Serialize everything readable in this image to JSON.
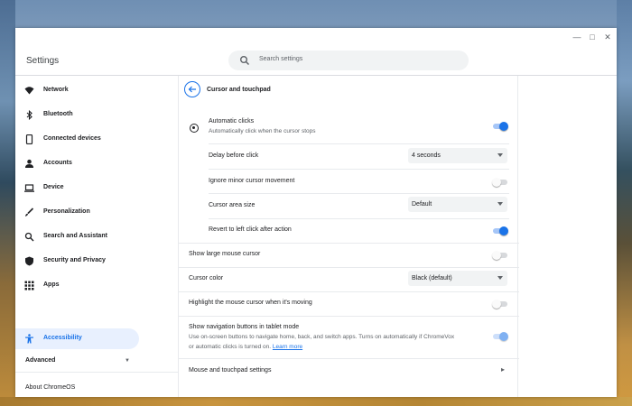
{
  "window": {
    "title": "Settings",
    "search_placeholder": "Search settings",
    "minimize_glyph": "—",
    "maximize_glyph": "□",
    "close_glyph": "✕"
  },
  "sidebar": {
    "items": [
      {
        "label": "Network",
        "icon": "wifi-icon"
      },
      {
        "label": "Bluetooth",
        "icon": "bluetooth-icon"
      },
      {
        "label": "Connected devices",
        "icon": "phone-icon"
      },
      {
        "label": "Accounts",
        "icon": "person-icon"
      },
      {
        "label": "Device",
        "icon": "laptop-icon"
      },
      {
        "label": "Personalization",
        "icon": "brush-icon"
      },
      {
        "label": "Search and Assistant",
        "icon": "search-icon"
      },
      {
        "label": "Security and Privacy",
        "icon": "shield-icon"
      },
      {
        "label": "Apps",
        "icon": "apps-grid-icon"
      },
      {
        "label": "Accessibility",
        "icon": "accessibility-icon",
        "active": true
      }
    ],
    "advanced_label": "Advanced",
    "about_label": "About ChromeOS"
  },
  "page": {
    "heading": "Cursor and touchpad",
    "automatic_clicks": {
      "label": "Automatic clicks",
      "sublabel": "Automatically click when the cursor stops",
      "enabled": true
    },
    "delay_before_click": {
      "label": "Delay before click",
      "value": "4 seconds"
    },
    "ignore_minor_movement": {
      "label": "Ignore minor cursor movement",
      "enabled": false
    },
    "cursor_area_size": {
      "label": "Cursor area size",
      "value": "Default"
    },
    "revert_to_left_click": {
      "label": "Revert to left click after action",
      "enabled": true
    },
    "show_large_cursor": {
      "label": "Show large mouse cursor",
      "enabled": false
    },
    "cursor_color": {
      "label": "Cursor color",
      "value": "Black (default)"
    },
    "highlight_cursor": {
      "label": "Highlight the mouse cursor when it's moving",
      "enabled": false
    },
    "nav_buttons": {
      "label": "Show navigation buttons in tablet mode",
      "desc_line1": "Use on-screen buttons to navigate home, back, and switch apps. Turns on automatically if ChromeVox",
      "desc_line2": "or automatic clicks is turned on.",
      "learn_more": "Learn more",
      "enabled": true
    },
    "mouse_touchpad_settings": {
      "label": "Mouse and touchpad settings"
    }
  },
  "colors": {
    "accent": "#1a73e8",
    "active_bg": "#e8f0fe",
    "toggle_on_track": "#a6c6f7"
  }
}
